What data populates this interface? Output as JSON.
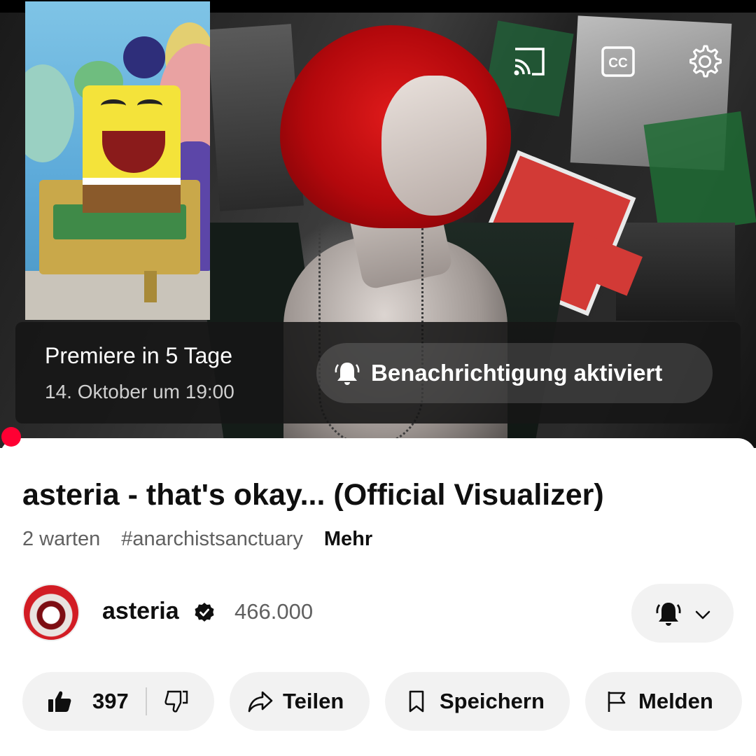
{
  "player": {
    "premiere_title": "Premiere in 5 Tage",
    "premiere_date": "14. Oktober um 19:00",
    "notify_label": "Benachrichtigung aktiviert",
    "icons": [
      "cast-icon",
      "closed-captions-icon",
      "gear-icon",
      "bell-ringing-icon"
    ],
    "progress_color": "#ff0033"
  },
  "video": {
    "title": "asteria - that's okay... (Official Visualizer)",
    "waiting": "2 warten",
    "hashtag": "#anarchistsanctuary",
    "more": "Mehr"
  },
  "channel": {
    "name": "asteria",
    "subscribers": "466.000",
    "verified": true
  },
  "actions": {
    "likes": "397",
    "share": "Teilen",
    "save": "Speichern",
    "report": "Melden"
  },
  "colors": {
    "accent": "#ff0033",
    "pill_bg": "#f2f2f2",
    "text": "#0f0f0f",
    "secondary_text": "#606060"
  }
}
